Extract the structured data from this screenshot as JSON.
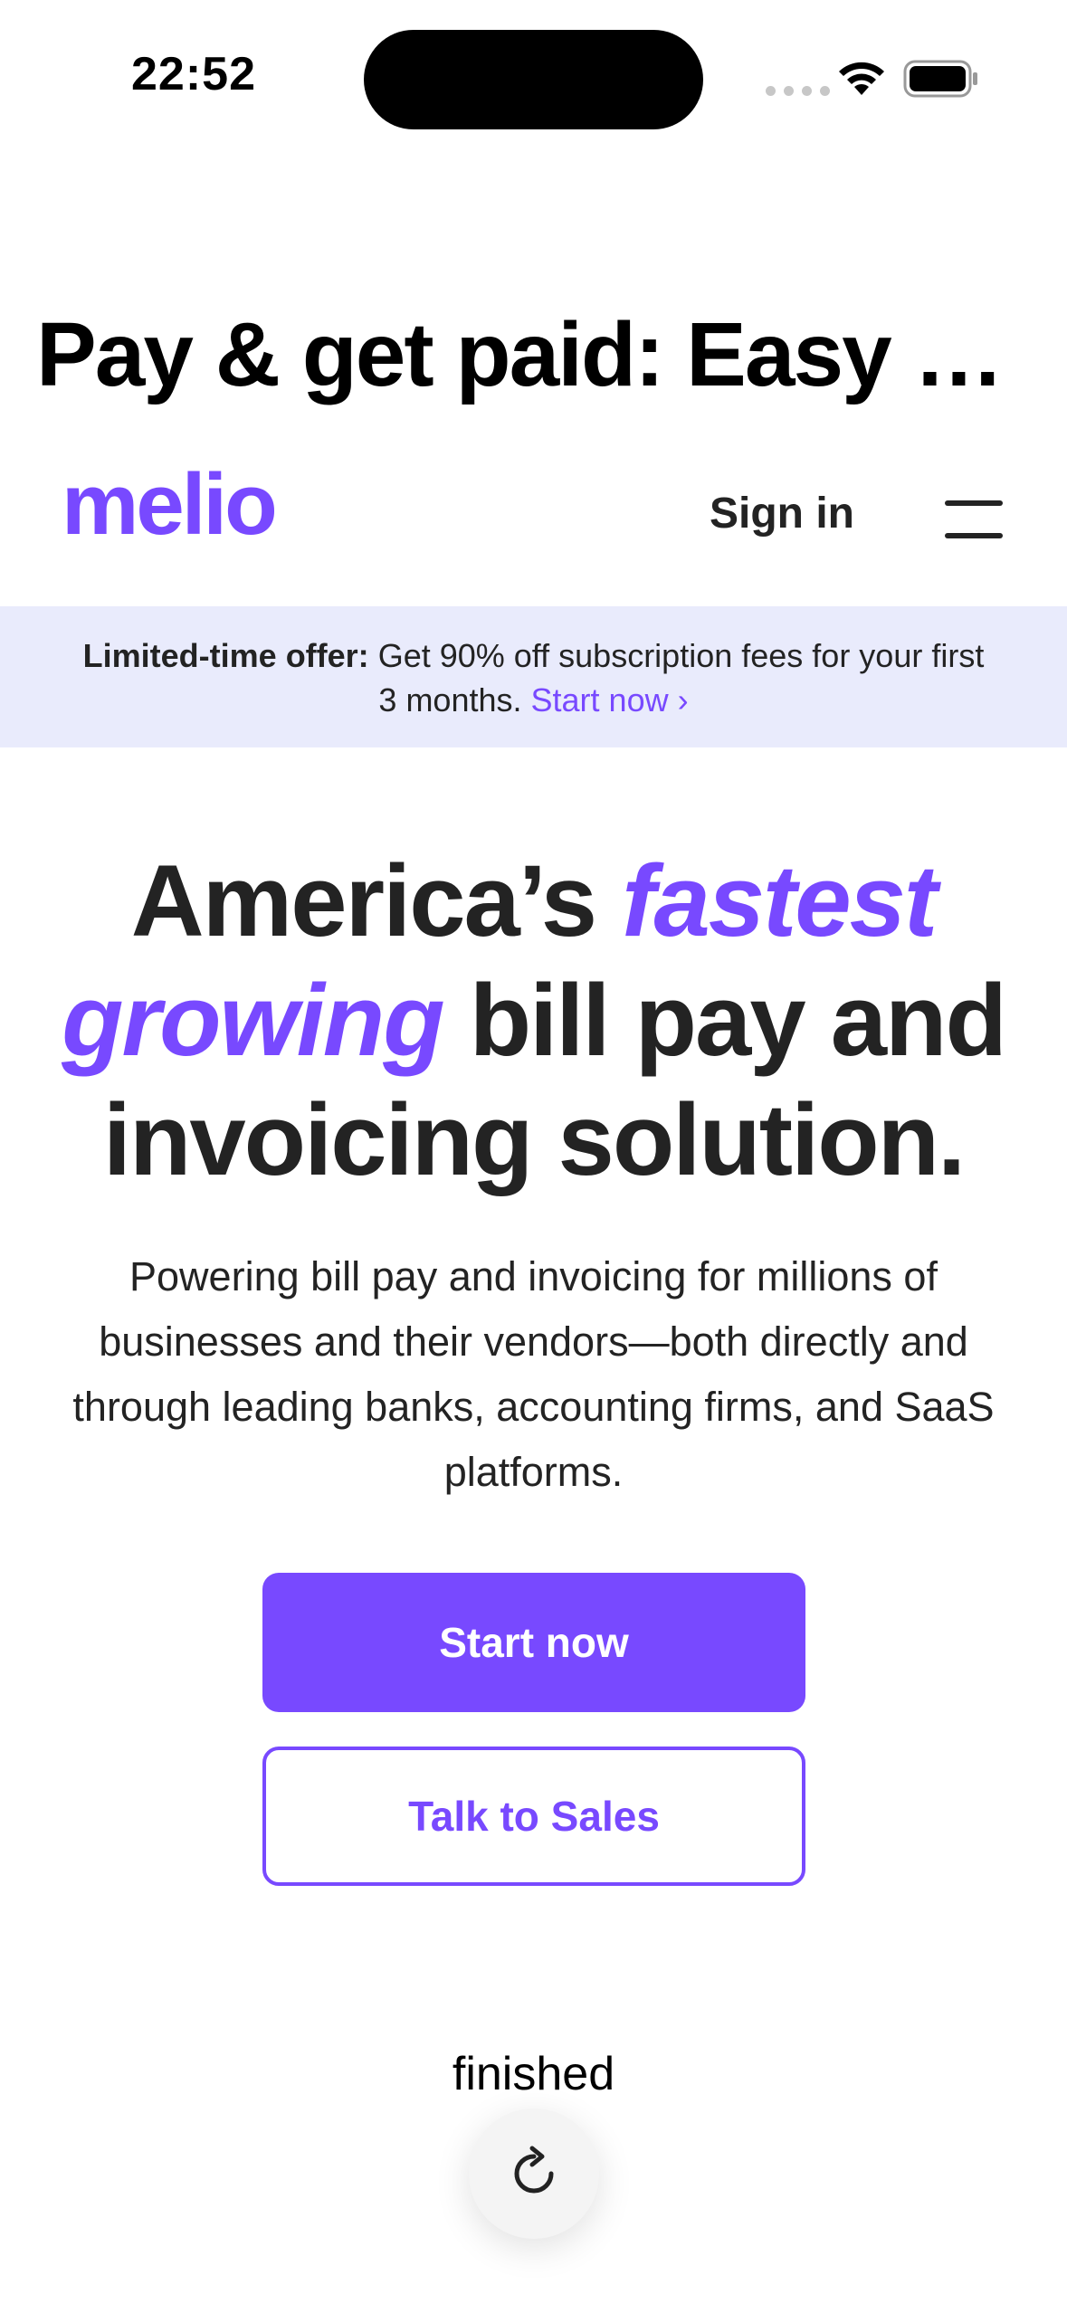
{
  "status_bar": {
    "time": "22:52"
  },
  "page_title": "Pay & get paid: Easy b...",
  "nav": {
    "logo_text": "melio",
    "sign_in": "Sign in",
    "menu_icon": "hamburger-icon"
  },
  "promo": {
    "bold": "Limited-time offer:",
    "text": " Get 90% off subscription fees for your first 3 months. ",
    "link": "Start now ›"
  },
  "hero": {
    "heading_pre": "America’s ",
    "heading_accent": "fastest growing",
    "heading_post": " bill pay and invoicing solution.",
    "subtext": "Powering bill pay and invoicing for millions of businesses and their vendors—both directly and through leading banks, accounting firms, and SaaS platforms."
  },
  "buttons": {
    "primary": "Start now",
    "secondary": "Talk to Sales"
  },
  "footer": {
    "status_text": "finished",
    "reload_icon": "reload-icon"
  },
  "colors": {
    "brand": "#7849ff",
    "banner_bg": "#e9ebfc",
    "text": "#232323"
  }
}
